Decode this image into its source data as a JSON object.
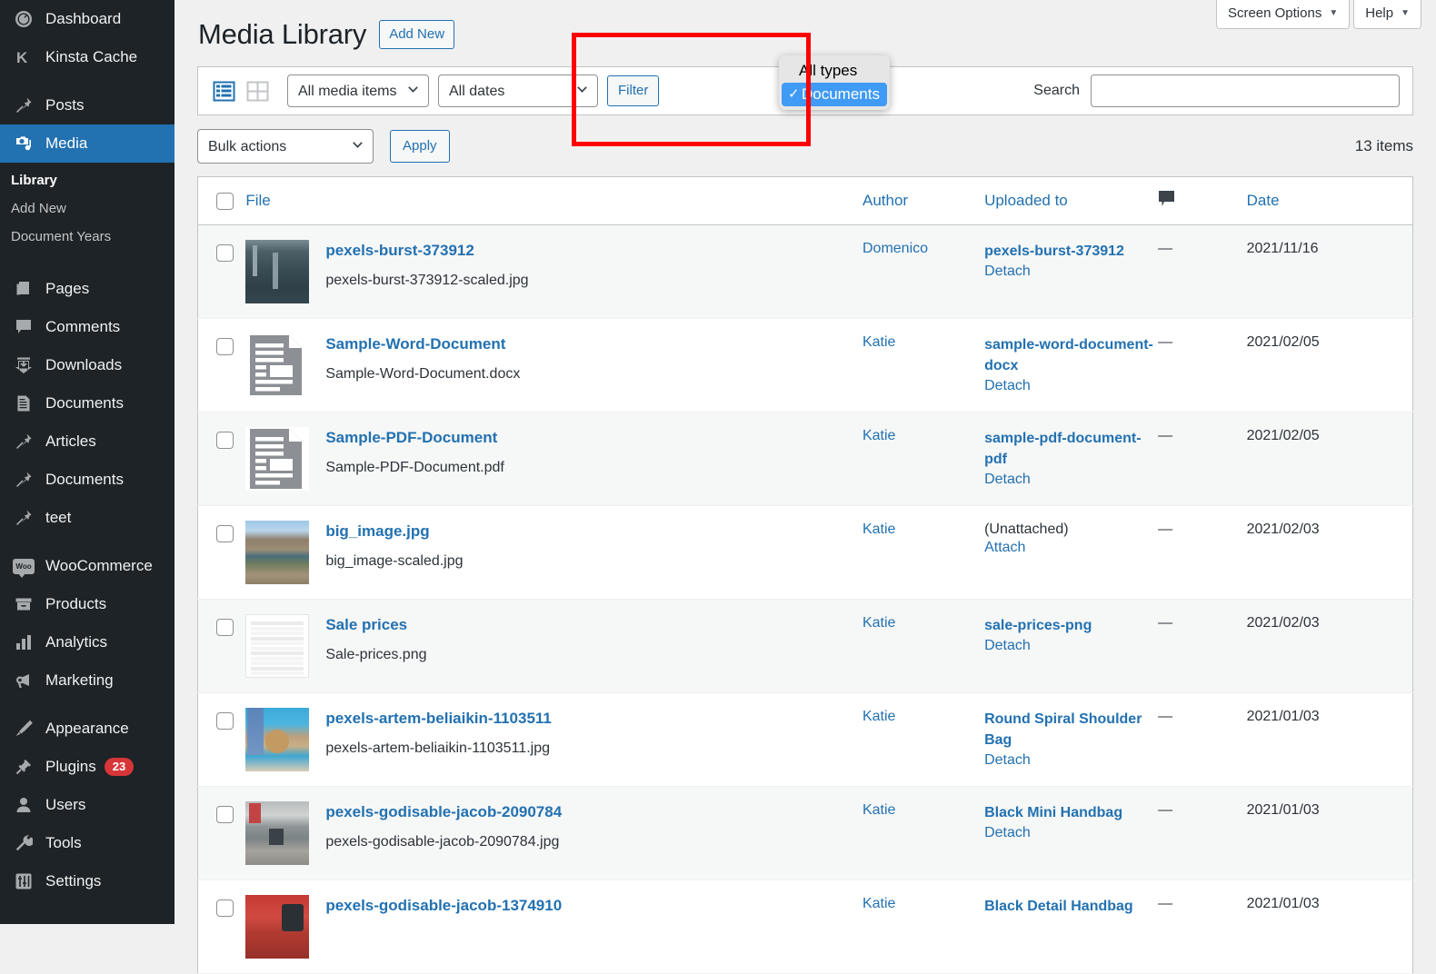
{
  "sidebar": {
    "items": [
      {
        "label": "Dashboard",
        "icon": "dashboard-icon",
        "current": false
      },
      {
        "label": "Kinsta Cache",
        "icon": "kinsta-icon",
        "current": false
      },
      {
        "label": "Posts",
        "icon": "pin-icon",
        "current": false
      },
      {
        "label": "Media",
        "icon": "media-icon",
        "current": true
      },
      {
        "label": "Pages",
        "icon": "pages-icon",
        "current": false
      },
      {
        "label": "Comments",
        "icon": "comment-icon",
        "current": false
      },
      {
        "label": "Downloads",
        "icon": "download-icon",
        "current": false
      },
      {
        "label": "Documents",
        "icon": "document-icon",
        "current": false
      },
      {
        "label": "Articles",
        "icon": "pin-icon",
        "current": false
      },
      {
        "label": "Documents",
        "icon": "pin-icon",
        "current": false
      },
      {
        "label": "teet",
        "icon": "pin-icon",
        "current": false
      },
      {
        "label": "WooCommerce",
        "icon": "woo-icon",
        "current": false
      },
      {
        "label": "Products",
        "icon": "products-icon",
        "current": false
      },
      {
        "label": "Analytics",
        "icon": "analytics-icon",
        "current": false
      },
      {
        "label": "Marketing",
        "icon": "marketing-icon",
        "current": false
      },
      {
        "label": "Appearance",
        "icon": "brush-icon",
        "current": false
      },
      {
        "label": "Plugins",
        "icon": "plug-icon",
        "current": false,
        "badge": "23"
      },
      {
        "label": "Users",
        "icon": "user-icon",
        "current": false
      },
      {
        "label": "Tools",
        "icon": "wrench-icon",
        "current": false
      },
      {
        "label": "Settings",
        "icon": "settings-icon",
        "current": false
      }
    ],
    "submenu": [
      {
        "label": "Library",
        "current": true
      },
      {
        "label": "Add New",
        "current": false
      },
      {
        "label": "Document Years",
        "current": false
      }
    ]
  },
  "screen_meta": {
    "screen_options": "Screen Options",
    "help": "Help",
    "caret": "▼"
  },
  "header": {
    "title": "Media Library",
    "add_new": "Add New"
  },
  "filter_bar": {
    "view_list_icon": "list-view-icon",
    "view_grid_icon": "grid-view-icon",
    "media_type": "All media items",
    "dates": "All dates",
    "filter_button": "Filter",
    "search_label": "Search",
    "search_value": "",
    "search_placeholder": ""
  },
  "type_dropdown": {
    "options": [
      {
        "label": "All types",
        "selected": false
      },
      {
        "label": "Documents",
        "selected": true
      }
    ],
    "checkmark": "✓",
    "highlight_color": "#3f9bf5",
    "annotation_color": "#fe0000"
  },
  "bulk": {
    "action": "Bulk actions",
    "apply": "Apply",
    "item_count": "13 items"
  },
  "table": {
    "columns": {
      "file": "File",
      "author": "Author",
      "uploaded_to": "Uploaded to",
      "comments_icon": "comment-bubble-icon",
      "date": "Date"
    },
    "rows": [
      {
        "title": "pexels-burst-373912",
        "filename": "pexels-burst-373912-scaled.jpg",
        "author": "Domenico",
        "uploaded_to": "pexels-burst-373912",
        "attach_action": "Detach",
        "comments": "—",
        "date": "2021/11/16",
        "thumb": "ph-burst"
      },
      {
        "title": "Sample-Word-Document",
        "filename": "Sample-Word-Document.docx",
        "author": "Katie",
        "uploaded_to": "sample-word-document-docx",
        "attach_action": "Detach",
        "comments": "—",
        "date": "2021/02/05",
        "thumb": "doc-icon"
      },
      {
        "title": "Sample-PDF-Document",
        "filename": "Sample-PDF-Document.pdf",
        "author": "Katie",
        "uploaded_to": "sample-pdf-document-pdf",
        "attach_action": "Detach",
        "comments": "—",
        "date": "2021/02/05",
        "thumb": "doc-icon"
      },
      {
        "title": "big_image.jpg",
        "filename": "big_image-scaled.jpg",
        "author": "Katie",
        "uploaded_to": "(Unattached)",
        "attach_action": "Attach",
        "comments": "—",
        "date": "2021/02/03",
        "thumb": "ph-big"
      },
      {
        "title": "Sale prices",
        "filename": "Sale-prices.png",
        "author": "Katie",
        "uploaded_to": "sale-prices-png",
        "attach_action": "Detach",
        "comments": "—",
        "date": "2021/02/03",
        "thumb": "ph-sale"
      },
      {
        "title": "pexels-artem-beliaikin-1103511",
        "filename": "pexels-artem-beliaikin-1103511.jpg",
        "author": "Katie",
        "uploaded_to": "Round Spiral Shoulder Bag",
        "attach_action": "Detach",
        "comments": "—",
        "date": "2021/01/03",
        "thumb": "ph-artem"
      },
      {
        "title": "pexels-godisable-jacob-2090784",
        "filename": "pexels-godisable-jacob-2090784.jpg",
        "author": "Katie",
        "uploaded_to": "Black Mini Handbag",
        "attach_action": "Detach",
        "comments": "—",
        "date": "2021/01/03",
        "thumb": "ph-jacob1"
      },
      {
        "title": "pexels-godisable-jacob-1374910",
        "filename": "",
        "author": "Katie",
        "uploaded_to": "Black Detail Handbag",
        "attach_action": "",
        "comments": "—",
        "date": "2021/01/03",
        "thumb": "ph-jacob2"
      }
    ]
  }
}
